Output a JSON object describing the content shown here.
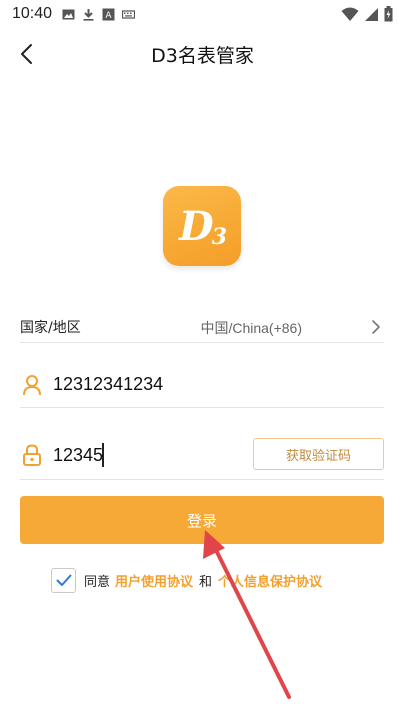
{
  "status_bar": {
    "time": "10:40"
  },
  "header": {
    "title": "D3名表管家",
    "back_icon": "chevron-left-icon"
  },
  "logo": {
    "text": "D",
    "sub": "3"
  },
  "country_row": {
    "label": "国家/地区",
    "value": "中国/China(+86)"
  },
  "phone_field": {
    "value": "12312341234",
    "icon": "user-icon"
  },
  "code_field": {
    "value": "12345",
    "icon": "lock-icon",
    "button_label": "获取验证码"
  },
  "login_button": {
    "label": "登录"
  },
  "agreement": {
    "checked": true,
    "prefix": "同意",
    "user_agreement": "用户使用协议",
    "and": "和",
    "privacy_policy": "个人信息保护协议"
  },
  "colors": {
    "accent": "#f7a937",
    "link": "#f0a12f",
    "annotation_arrow": "#e0454a"
  }
}
